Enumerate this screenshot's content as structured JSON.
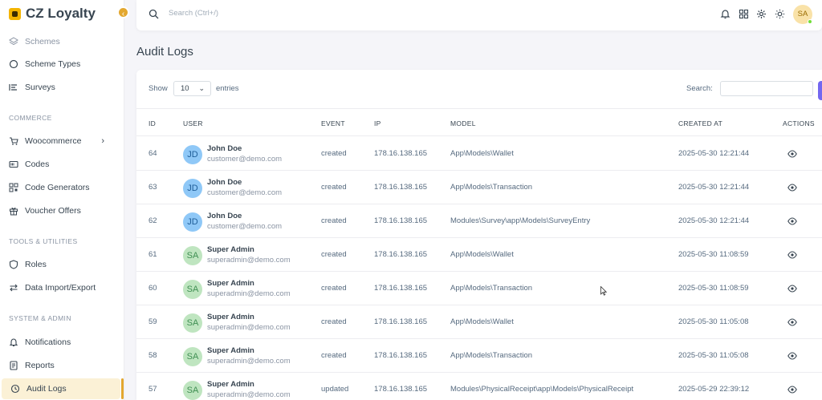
{
  "brand": {
    "name": "CZ Loyalty"
  },
  "sidebar": {
    "items": [
      {
        "label": "Schemes",
        "icon": "layers-icon"
      },
      {
        "label": "Scheme Types",
        "icon": "circle-icon"
      },
      {
        "label": "Surveys",
        "icon": "list-icon"
      },
      {
        "label": "Woocommerce",
        "icon": "cart-icon"
      },
      {
        "label": "Codes",
        "icon": "barcode-icon"
      },
      {
        "label": "Code Generators",
        "icon": "qrcode-icon"
      },
      {
        "label": "Voucher Offers",
        "icon": "gift-icon"
      },
      {
        "label": "Roles",
        "icon": "shield-icon"
      },
      {
        "label": "Data Import/Export",
        "icon": "transfer-icon"
      },
      {
        "label": "Notifications",
        "icon": "bell-icon"
      },
      {
        "label": "Reports",
        "icon": "report-icon"
      },
      {
        "label": "Audit Logs",
        "icon": "history-icon"
      }
    ],
    "sections": {
      "commerce": "COMMERCE",
      "tools": "TOOLS & UTILITIES",
      "system": "SYSTEM & ADMIN"
    }
  },
  "topbar": {
    "search_placeholder": "Search (Ctrl+/)",
    "avatar_initials": "SA"
  },
  "page": {
    "title": "Audit Logs"
  },
  "table": {
    "show_label": "Show",
    "entries_value": "10",
    "entries_label": "entries",
    "search_label": "Search:",
    "headers": {
      "id": "ID",
      "user": "USER",
      "event": "EVENT",
      "ip": "IP",
      "model": "MODEL",
      "created_at": "CREATED AT",
      "actions": "ACTIONS"
    },
    "rows": [
      {
        "id": "64",
        "initials": "JD",
        "name": "John Doe",
        "email": "customer@demo.com",
        "event": "created",
        "ip": "178.16.138.165",
        "model": "App\\Models\\Wallet",
        "created_at": "2025-05-30 12:21:44"
      },
      {
        "id": "63",
        "initials": "JD",
        "name": "John Doe",
        "email": "customer@demo.com",
        "event": "created",
        "ip": "178.16.138.165",
        "model": "App\\Models\\Transaction",
        "created_at": "2025-05-30 12:21:44"
      },
      {
        "id": "62",
        "initials": "JD",
        "name": "John Doe",
        "email": "customer@demo.com",
        "event": "created",
        "ip": "178.16.138.165",
        "model": "Modules\\Survey\\app\\Models\\SurveyEntry",
        "created_at": "2025-05-30 12:21:44"
      },
      {
        "id": "61",
        "initials": "SA",
        "name": "Super Admin",
        "email": "superadmin@demo.com",
        "event": "created",
        "ip": "178.16.138.165",
        "model": "App\\Models\\Wallet",
        "created_at": "2025-05-30 11:08:59"
      },
      {
        "id": "60",
        "initials": "SA",
        "name": "Super Admin",
        "email": "superadmin@demo.com",
        "event": "created",
        "ip": "178.16.138.165",
        "model": "App\\Models\\Transaction",
        "created_at": "2025-05-30 11:08:59"
      },
      {
        "id": "59",
        "initials": "SA",
        "name": "Super Admin",
        "email": "superadmin@demo.com",
        "event": "created",
        "ip": "178.16.138.165",
        "model": "App\\Models\\Wallet",
        "created_at": "2025-05-30 11:05:08"
      },
      {
        "id": "58",
        "initials": "SA",
        "name": "Super Admin",
        "email": "superadmin@demo.com",
        "event": "created",
        "ip": "178.16.138.165",
        "model": "App\\Models\\Transaction",
        "created_at": "2025-05-30 11:05:08"
      },
      {
        "id": "57",
        "initials": "SA",
        "name": "Super Admin",
        "email": "superadmin@demo.com",
        "event": "updated",
        "ip": "178.16.138.165",
        "model": "Modules\\PhysicalReceipt\\app\\Models\\PhysicalReceipt",
        "created_at": "2025-05-29 22:39:12"
      }
    ]
  },
  "colors": {
    "accent": "#e3a72f",
    "active_bg": "#fbf1d6",
    "primary": "#7367f0"
  }
}
